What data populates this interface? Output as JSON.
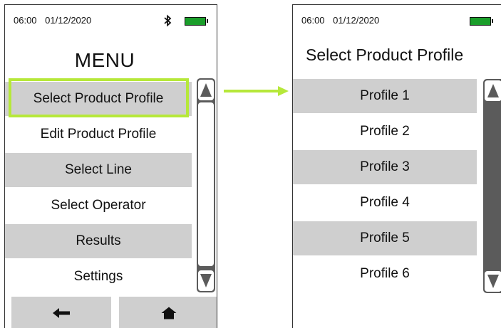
{
  "colors": {
    "highlight": "#b6e83a",
    "row_shaded": "#cfcfcf",
    "scrollbar": "#5b5b5b",
    "battery": "#1a9e2a",
    "arrow": "#b6e83a"
  },
  "left_screen": {
    "status": {
      "time": "06:00",
      "date": "01/12/2020",
      "icons": [
        "bluetooth-icon",
        "battery-icon"
      ]
    },
    "title": "MENU",
    "menu": [
      {
        "label": "Select Product Profile",
        "selected": true,
        "shaded": true
      },
      {
        "label": "Edit Product Profile",
        "shaded": false
      },
      {
        "label": "Select Line",
        "shaded": true
      },
      {
        "label": "Select Operator",
        "shaded": false
      },
      {
        "label": "Results",
        "shaded": true
      },
      {
        "label": "Settings",
        "shaded": false
      }
    ],
    "bottom_buttons": [
      {
        "icon": "back-arrow-icon"
      },
      {
        "icon": "home-icon"
      }
    ]
  },
  "right_screen": {
    "status": {
      "time": "06:00",
      "date": "01/12/2020",
      "icons": [
        "battery-icon"
      ]
    },
    "title": "Select Product Profile",
    "profiles": [
      {
        "label": "Profile 1",
        "shaded": true
      },
      {
        "label": "Profile 2",
        "shaded": false
      },
      {
        "label": "Profile 3",
        "shaded": true
      },
      {
        "label": "Profile 4",
        "shaded": false
      },
      {
        "label": "Profile 5",
        "shaded": true
      },
      {
        "label": "Profile 6",
        "shaded": false
      }
    ]
  }
}
